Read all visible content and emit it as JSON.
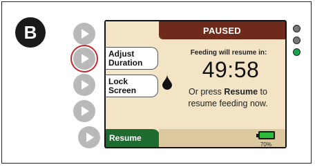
{
  "badge": "B",
  "header": {
    "title": "PAUSED"
  },
  "soft_keys": {
    "adjust_duration": [
      "Adjust",
      "Duration"
    ],
    "lock_screen": [
      "Lock",
      "Screen"
    ],
    "resume": "Resume"
  },
  "main": {
    "message": "Feeding will resume in:",
    "timer": "49:58",
    "instruction_prefix": "Or press",
    "instruction_bold": "Resume",
    "instruction_suffix": "to",
    "instruction_line2": "resume feeding now."
  },
  "status": {
    "battery_percent": "70%",
    "battery_level": 0.7
  },
  "leds": [
    {
      "name": "led-top",
      "color": "#777777"
    },
    {
      "name": "led-middle",
      "color": "#777777"
    },
    {
      "name": "led-bottom",
      "color": "#1aa54a"
    }
  ],
  "colors": {
    "header": "#6e2a1b",
    "screen_bg": "#f3e4c6",
    "resume": "#1e6a2f",
    "selection_ring": "#c0282e"
  },
  "side_buttons": [
    {
      "name": "side-button-1",
      "selected": false
    },
    {
      "name": "side-button-2",
      "selected": true
    },
    {
      "name": "side-button-3",
      "selected": false
    },
    {
      "name": "side-button-4",
      "selected": false
    },
    {
      "name": "side-button-5",
      "selected": false
    }
  ]
}
